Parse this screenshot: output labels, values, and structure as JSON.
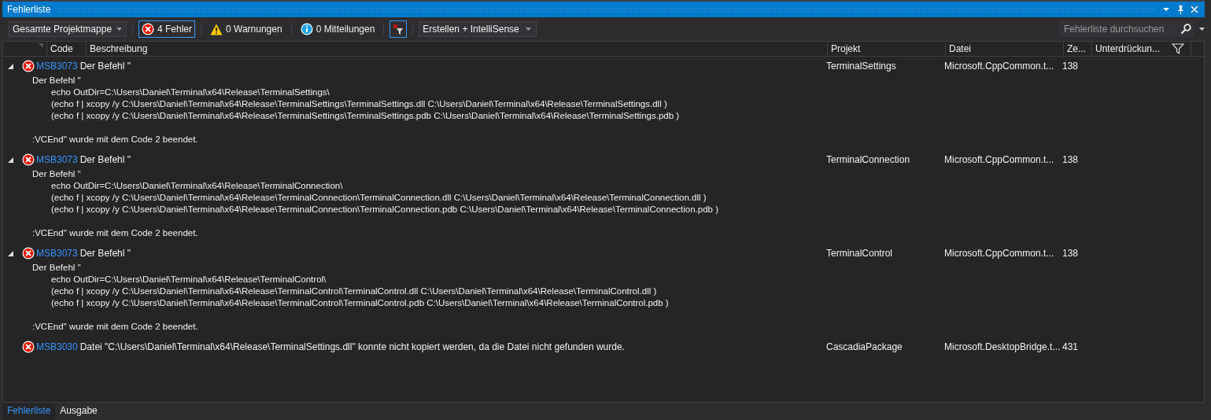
{
  "window": {
    "title": "Fehlerliste"
  },
  "toolbar": {
    "scope": "Gesamte Projektmappe",
    "filters": [
      {
        "kind": "error",
        "label": "4 Fehler",
        "selected": true
      },
      {
        "kind": "warning",
        "label": "0 Warnungen",
        "selected": false
      },
      {
        "kind": "info",
        "label": "0 Mitteilungen",
        "selected": false
      }
    ],
    "filter_toggle": {
      "selected": true
    },
    "source": "Erstellen + IntelliSense",
    "search": {
      "placeholder": "Fehlerliste durchsuchen"
    }
  },
  "table": {
    "columns": [
      "Code",
      "Beschreibung",
      "Projekt",
      "Datei",
      "Ze...",
      "Unterdrückun..."
    ],
    "rows": [
      {
        "code": "MSB3073",
        "description": "Der Befehl \"",
        "project": "TerminalSettings",
        "file": "Microsoft.CppCommon.t...",
        "line": "138",
        "expanded": true,
        "detail": {
          "head": "Der Befehl \"",
          "commands": [
            "echo OutDir=C:\\Users\\Daniel\\Terminal\\x64\\Release\\TerminalSettings\\",
            "(echo f | xcopy /y C:\\Users\\Daniel\\Terminal\\x64\\Release\\TerminalSettings\\TerminalSettings.dll C:\\Users\\Daniel\\Terminal\\x64\\Release\\TerminalSettings.dll )",
            "(echo f | xcopy /y C:\\Users\\Daniel\\Terminal\\x64\\Release\\TerminalSettings\\TerminalSettings.pdb C:\\Users\\Daniel\\Terminal\\x64\\Release\\TerminalSettings.pdb )"
          ],
          "tail": ":VCEnd\" wurde mit dem Code 2 beendet."
        }
      },
      {
        "code": "MSB3073",
        "description": "Der Befehl \"",
        "project": "TerminalConnection",
        "file": "Microsoft.CppCommon.t...",
        "line": "138",
        "expanded": true,
        "detail": {
          "head": "Der Befehl \"",
          "commands": [
            "echo OutDir=C:\\Users\\Daniel\\Terminal\\x64\\Release\\TerminalConnection\\",
            "(echo f | xcopy /y C:\\Users\\Daniel\\Terminal\\x64\\Release\\TerminalConnection\\TerminalConnection.dll C:\\Users\\Daniel\\Terminal\\x64\\Release\\TerminalConnection.dll )",
            "(echo f | xcopy /y C:\\Users\\Daniel\\Terminal\\x64\\Release\\TerminalConnection\\TerminalConnection.pdb C:\\Users\\Daniel\\Terminal\\x64\\Release\\TerminalConnection.pdb )"
          ],
          "tail": ":VCEnd\" wurde mit dem Code 2 beendet."
        }
      },
      {
        "code": "MSB3073",
        "description": "Der Befehl \"",
        "project": "TerminalControl",
        "file": "Microsoft.CppCommon.t...",
        "line": "138",
        "expanded": true,
        "detail": {
          "head": "Der Befehl \"",
          "commands": [
            "echo OutDir=C:\\Users\\Daniel\\Terminal\\x64\\Release\\TerminalControl\\",
            "(echo f | xcopy /y C:\\Users\\Daniel\\Terminal\\x64\\Release\\TerminalControl\\TerminalControl.dll C:\\Users\\Daniel\\Terminal\\x64\\Release\\TerminalControl.dll )",
            "(echo f | xcopy /y C:\\Users\\Daniel\\Terminal\\x64\\Release\\TerminalControl\\TerminalControl.pdb C:\\Users\\Daniel\\Terminal\\x64\\Release\\TerminalControl.pdb )"
          ],
          "tail": ":VCEnd\" wurde mit dem Code 2 beendet."
        }
      },
      {
        "code": "MSB3030",
        "description": "Datei \"C:\\Users\\Daniel\\Terminal\\x64\\Release\\TerminalSettings.dll\" konnte nicht kopiert werden, da die Datei nicht gefunden wurde.",
        "project": "CascadiaPackage",
        "file": "Microsoft.DesktopBridge.t...",
        "line": "431"
      }
    ]
  },
  "bottom_tabs": [
    {
      "label": "Fehlerliste",
      "selected": true
    },
    {
      "label": "Ausgabe",
      "selected": false
    }
  ]
}
